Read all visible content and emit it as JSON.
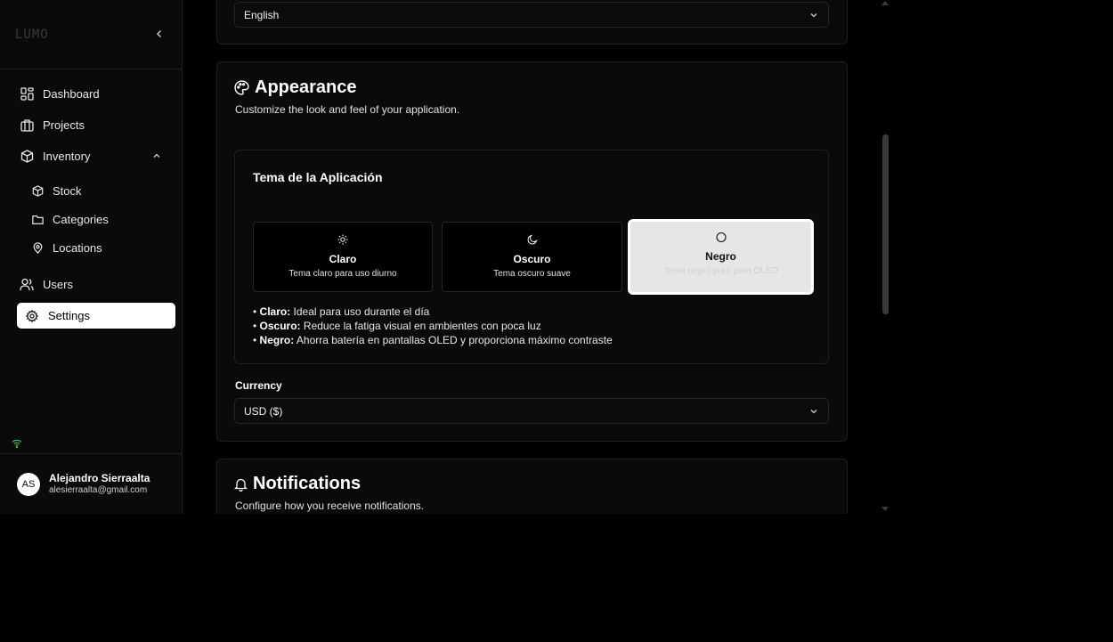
{
  "sidebar": {
    "logo": "LUMO",
    "nav": {
      "dashboard": "Dashboard",
      "projects": "Projects",
      "inventory": "Inventory",
      "stock": "Stock",
      "categories": "Categories",
      "locations": "Locations",
      "users": "Users",
      "settings": "Settings"
    },
    "user": {
      "initials": "AS",
      "name": "Alejandro Sierraalta",
      "email": "alesierraalta@gmail.com"
    }
  },
  "language": {
    "value": "English"
  },
  "appearance": {
    "title": "Appearance",
    "description": "Customize the look and feel of your application.",
    "theme_section_title": "Tema de la Aplicación",
    "themes": [
      {
        "name": "Claro",
        "description": "Tema claro para uso diurno",
        "icon": "sun-icon"
      },
      {
        "name": "Oscuro",
        "description": "Tema oscuro suave",
        "icon": "moon-icon"
      },
      {
        "name": "Negro",
        "description": "Tema negro puro para OLED",
        "icon": "circle-icon"
      }
    ],
    "selected_theme": "Negro",
    "notes": [
      {
        "term": "Claro:",
        "text": " Ideal para uso durante el día"
      },
      {
        "term": "Oscuro:",
        "text": " Reduce la fatiga visual en ambientes con poca luz"
      },
      {
        "term": "Negro:",
        "text": " Ahorra batería en pantallas OLED y proporciona máximo contraste"
      }
    ],
    "currency_label": "Currency",
    "currency_value": "USD ($)"
  },
  "notifications": {
    "title": "Notifications",
    "description": "Configure how you receive notifications."
  },
  "colors": {
    "status_online": "#22c55e",
    "selected_theme_bg": "#e6e6e6"
  }
}
